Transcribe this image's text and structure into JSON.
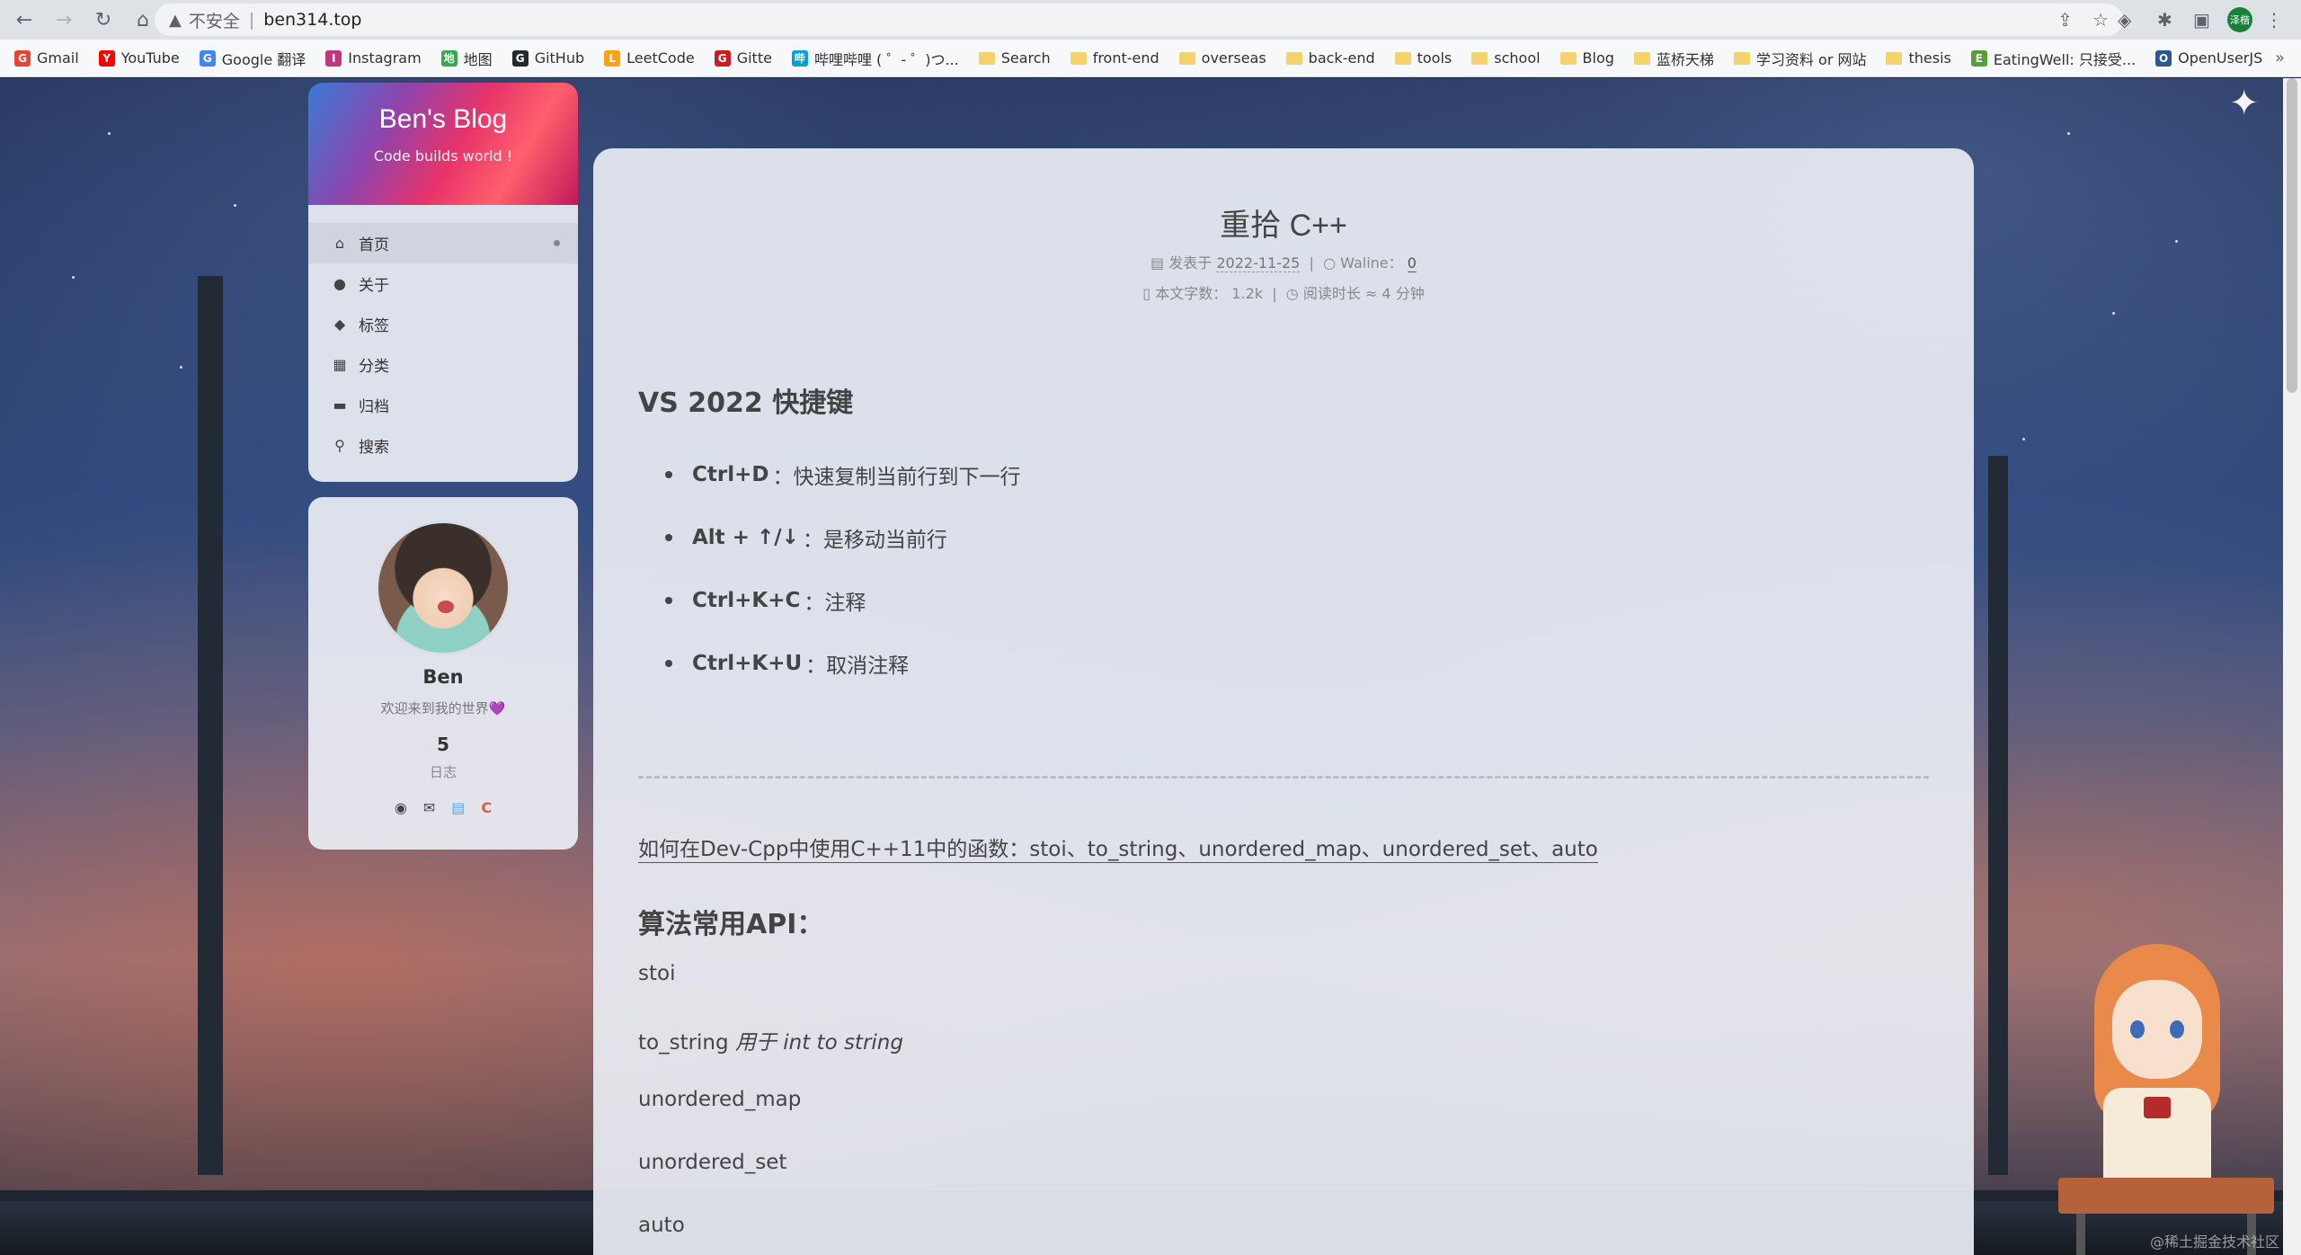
{
  "browser": {
    "insecure_label": "不安全",
    "url": "ben314.top",
    "profile_initials": "泽楷"
  },
  "bookmarks": [
    {
      "label": "Gmail",
      "icon": "gmail-icon",
      "color": "#ea4335"
    },
    {
      "label": "YouTube",
      "icon": "youtube-icon",
      "color": "#ff0000"
    },
    {
      "label": "Google 翻译",
      "icon": "google-translate-icon",
      "color": "#4285f4"
    },
    {
      "label": "Instagram",
      "icon": "instagram-icon",
      "color": "#c13584"
    },
    {
      "label": "地图",
      "icon": "maps-icon",
      "color": "#34a853"
    },
    {
      "label": "GitHub",
      "icon": "github-icon",
      "color": "#24292e"
    },
    {
      "label": "LeetCode",
      "icon": "leetcode-icon",
      "color": "#ffa116"
    },
    {
      "label": "Gitte",
      "icon": "gitee-icon",
      "color": "#c71d23"
    },
    {
      "label": "哔哩哔哩 ( ゜- ゜)つ...",
      "icon": "bilibili-icon",
      "color": "#00a1d6"
    },
    {
      "label": "Search",
      "icon": "folder-icon"
    },
    {
      "label": "front-end",
      "icon": "folder-icon"
    },
    {
      "label": "overseas",
      "icon": "folder-icon"
    },
    {
      "label": "back-end",
      "icon": "folder-icon"
    },
    {
      "label": "tools",
      "icon": "folder-icon"
    },
    {
      "label": "school",
      "icon": "folder-icon"
    },
    {
      "label": "Blog",
      "icon": "folder-icon"
    },
    {
      "label": "蓝桥天梯",
      "icon": "folder-icon"
    },
    {
      "label": "学习资料 or 网站",
      "icon": "folder-icon"
    },
    {
      "label": "thesis",
      "icon": "folder-icon"
    },
    {
      "label": "EatingWell: 只接受...",
      "icon": "eatingwell-icon",
      "color": "#5a9e3a"
    },
    {
      "label": "OpenUserJS",
      "icon": "openuserjs-icon",
      "color": "#2b5797"
    }
  ],
  "sidebar": {
    "brand_title": "Ben's Blog",
    "brand_subtitle": "Code builds world !",
    "menu": [
      {
        "label": "首页",
        "icon": "home-icon",
        "active": true
      },
      {
        "label": "关于",
        "icon": "user-icon"
      },
      {
        "label": "标签",
        "icon": "tags-icon"
      },
      {
        "label": "分类",
        "icon": "grid-icon"
      },
      {
        "label": "归档",
        "icon": "archive-icon"
      },
      {
        "label": "搜索",
        "icon": "search-icon"
      }
    ],
    "profile": {
      "name": "Ben",
      "description": "欢迎来到我的世界💜",
      "posts_count": "5",
      "posts_label": "日志",
      "links": [
        "github-icon",
        "email-icon",
        "calendar-icon",
        "csdn-icon"
      ]
    }
  },
  "article": {
    "title": "重拾 C++",
    "posted_label": "发表于",
    "date": "2022-11-25",
    "comment_label": "Waline：",
    "comment_count": "0",
    "wordcount_label": "本文字数：",
    "wordcount": "1.2k",
    "readtime_label": "阅读时长 ≈",
    "readtime": "4 分钟",
    "section1_title": "VS 2022 快捷键",
    "shortcuts": [
      {
        "key": "Ctrl+D",
        "desc": "：快速复制当前行到下一行"
      },
      {
        "key": "Alt + ↑/↓",
        "desc": "：是移动当前行"
      },
      {
        "key": "Ctrl+K+C",
        "desc": "：注释"
      },
      {
        "key": "Ctrl+K+U",
        "desc": "：取消注释"
      }
    ],
    "link_text": "如何在Dev-Cpp中使用C++11中的函数：stoi、to_string、unordered_map、unordered_set、auto",
    "section2_title": "算法常用API：",
    "api_lines": [
      {
        "text": "stoi",
        "note": ""
      },
      {
        "text": "to_string",
        "note": "用于 int to string"
      },
      {
        "text": "unordered_map",
        "note": ""
      },
      {
        "text": "unordered_set",
        "note": ""
      },
      {
        "text": "auto",
        "note": ""
      }
    ]
  },
  "watermark": "@稀土掘金技术社区"
}
